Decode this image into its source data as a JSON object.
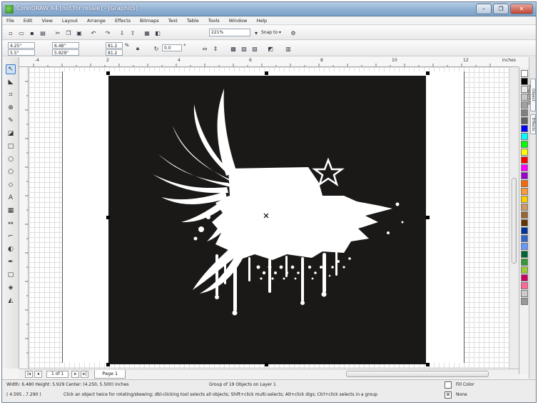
{
  "window": {
    "title": "CorelDRAW X4 [not for resale] - [Graphics]",
    "controls": [
      "–",
      "❐",
      "✕"
    ]
  },
  "menu": [
    "File",
    "Edit",
    "View",
    "Layout",
    "Arrange",
    "Effects",
    "Bitmaps",
    "Text",
    "Table",
    "Tools",
    "Window",
    "Help"
  ],
  "toolbar": {
    "zoom_level": "221%",
    "snap_to": "Snap to ▾"
  },
  "property_bar": {
    "x": "4.25\"",
    "y": "5.5\"",
    "width": "6.48\"",
    "height": "5.929\"",
    "scale_x": "81.2",
    "scale_y": "81.2",
    "percent": "%",
    "rotation": "0.0",
    "degree": "°"
  },
  "ruler": {
    "units": "inches",
    "ticks": [
      "-4",
      "",
      "2",
      "",
      "4",
      "",
      "6",
      "",
      "8",
      "",
      "10",
      "",
      "12"
    ]
  },
  "pages": {
    "count_text": "1 of 1",
    "tab_label": "Page 1"
  },
  "palette_colors": [
    "#ffffff",
    "#000000",
    "#e8e8e8",
    "#c8c8c8",
    "#a0a0a0",
    "#808080",
    "#606060",
    "#0000ff",
    "#00ffff",
    "#00ff00",
    "#ffff00",
    "#ff0000",
    "#ff00ff",
    "#9900cc",
    "#ff6600",
    "#ff9933",
    "#ffcc00",
    "#cc9966",
    "#996633",
    "#663300",
    "#003399",
    "#3366cc",
    "#6699ff",
    "#006633",
    "#339933",
    "#99cc33",
    "#cc0066",
    "#ff6699",
    "#cccccc",
    "#999999"
  ],
  "side_tabs": [
    "Object Properties",
    "Effects"
  ],
  "status": {
    "dims": "Width: 6.480  Height: 5.929  Center: (4.250, 5.500)  inches",
    "object_info": "Group of 19 Objects on Layer 1",
    "cursor": "( 4.595 , 7.290 )",
    "hint": "Click an object twice for rotating/skewing; dbl-clicking tool selects all objects; Shift+click multi-selects; Alt+click digs; Ctrl+click selects in a group",
    "fill_label": "Fill Color",
    "outline_label": "None"
  }
}
